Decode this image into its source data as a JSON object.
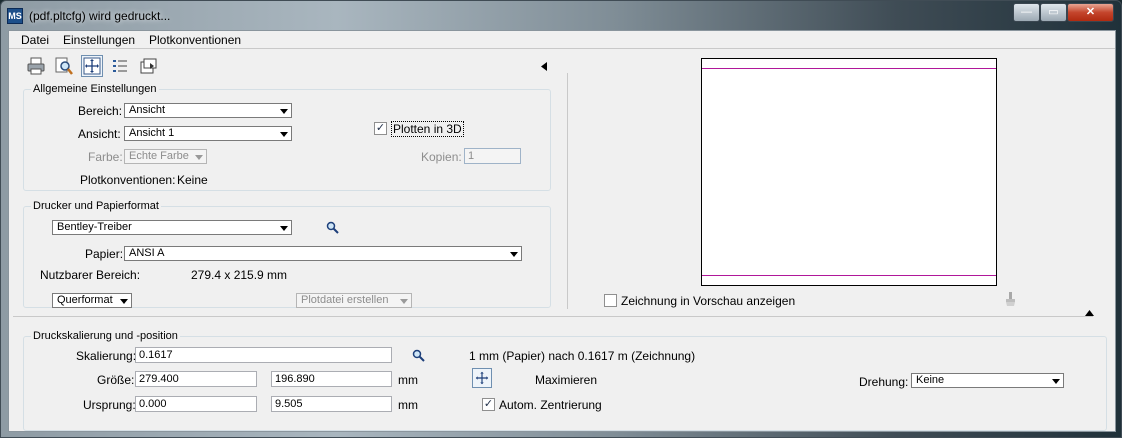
{
  "window": {
    "title": "(pdf.pltcfg) wird gedruckt...",
    "app_icon": "MS",
    "min_label": "—",
    "max_label": "▭",
    "close_label": "✕"
  },
  "menu": [
    {
      "label": "Datei"
    },
    {
      "label": "Einstellungen"
    },
    {
      "label": "Plotkonventionen"
    }
  ],
  "toolbar": {
    "icons": [
      "printer-icon",
      "preview-magnifier-icon",
      "fit-view-icon",
      "list-icon",
      "export-icon"
    ]
  },
  "general": {
    "title": "Allgemeine Einstellungen",
    "bereich_label": "Bereich:",
    "bereich_value": "Ansicht",
    "ansicht_label": "Ansicht:",
    "ansicht_value": "Ansicht 1",
    "farbe_label": "Farbe:",
    "farbe_value": "Echte Farbe",
    "plotkonv_label": "Plotkonventionen:",
    "plotkonv_value": "Keine",
    "plot3d_label": "Plotten in 3D",
    "plot3d_checked": true,
    "kopien_label": "Kopien:",
    "kopien_value": "1"
  },
  "printer": {
    "title": "Drucker und Papierformat",
    "driver_value": "Bentley-Treiber",
    "papier_label": "Papier:",
    "papier_value": "ANSI A",
    "nutzbar_label": "Nutzbarer Bereich:",
    "nutzbar_value": "279.4 x 215.9 mm",
    "orientation_value": "Querformat",
    "plotfile_value": "Plotdatei erstellen"
  },
  "preview": {
    "show_label": "Zeichnung in Vorschau anzeigen",
    "show_checked": false
  },
  "scale": {
    "title": "Druckskalierung und -position",
    "skalierung_label": "Skalierung:",
    "skalierung_value": "0.1617",
    "ratio_text": "1 mm (Papier) nach 0.1617 m (Zeichnung)",
    "groesse_label": "Größe:",
    "groesse_w": "279.400",
    "groesse_h": "196.890",
    "groesse_unit": "mm",
    "maximieren_label": "Maximieren",
    "ursprung_label": "Ursprung:",
    "ursprung_x": "0.000",
    "ursprung_y": "9.505",
    "ursprung_unit": "mm",
    "zentrierung_label": "Autom. Zentrierung",
    "zentrierung_checked": true,
    "drehung_label": "Drehung:",
    "drehung_value": "Keine"
  },
  "colors": {
    "accent_magenta": "#b0179a",
    "window_bg": "#f0f0f0"
  }
}
